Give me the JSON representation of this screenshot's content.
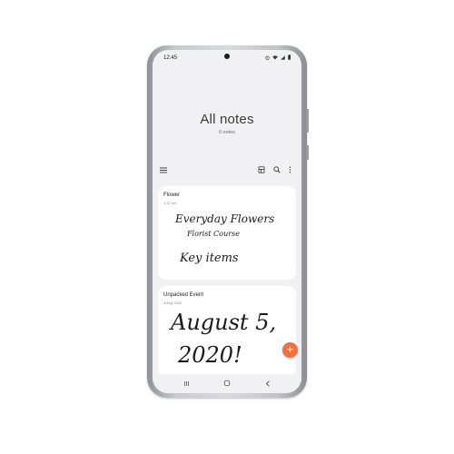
{
  "status_bar": {
    "time": "12:45",
    "icons": [
      "alarm-icon",
      "wifi-icon",
      "signal-icon",
      "battery-icon"
    ]
  },
  "header": {
    "title": "All notes",
    "note_count": "6 notes"
  },
  "toolbar": {
    "icons": [
      "menu-icon",
      "notes-view-icon",
      "search-icon",
      "more-options-icon"
    ]
  },
  "notes": [
    {
      "title": "Flower",
      "date": "1:47 pm",
      "handwriting": [
        "Everyday Flowers",
        "Florist Course",
        "Key items"
      ]
    },
    {
      "title": "Unpacked Event",
      "date": "3 Aug 2020",
      "handwriting": [
        "August 5,",
        "2020!"
      ]
    }
  ],
  "fab": {
    "label": "+"
  },
  "nav_bar": {
    "icons": [
      "recent-apps-icon",
      "home-icon",
      "back-icon"
    ]
  },
  "colors": {
    "accent": "#f36f3c",
    "screen_bg": "#f1f1f3",
    "card_bg": "#ffffff",
    "phone_frame": "#c9cacd"
  }
}
